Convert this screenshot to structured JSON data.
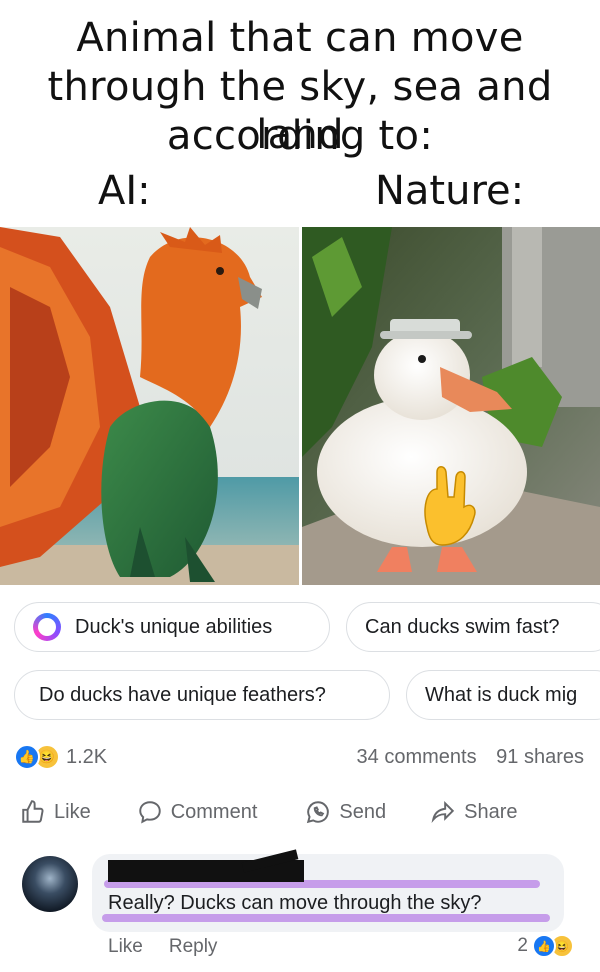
{
  "meme": {
    "line1": "Animal that can move",
    "line2": "through the sky, sea and land",
    "line3": "according to:",
    "label_ai": "AI:",
    "label_nature": "Nature:"
  },
  "suggestions": [
    {
      "label": "Duck's unique abilities",
      "icon": "meta-ai-icon"
    },
    {
      "label": "Can ducks swim fast?"
    },
    {
      "label": "Do ducks have unique feathers?"
    },
    {
      "label": "What is duck mig"
    }
  ],
  "stats": {
    "reaction_count": "1.2K",
    "comments": "34 comments",
    "shares": "91 shares"
  },
  "actions": {
    "like": "Like",
    "comment": "Comment",
    "send": "Send",
    "share": "Share"
  },
  "comment": {
    "text": "Really? Ducks can move through the sky?",
    "like": "Like",
    "reply": "Reply",
    "reaction_count": "2"
  },
  "colors": {
    "like_blue": "#1877f2",
    "haha_yellow": "#f7c23b",
    "highlight_purple": "#b880e6"
  }
}
